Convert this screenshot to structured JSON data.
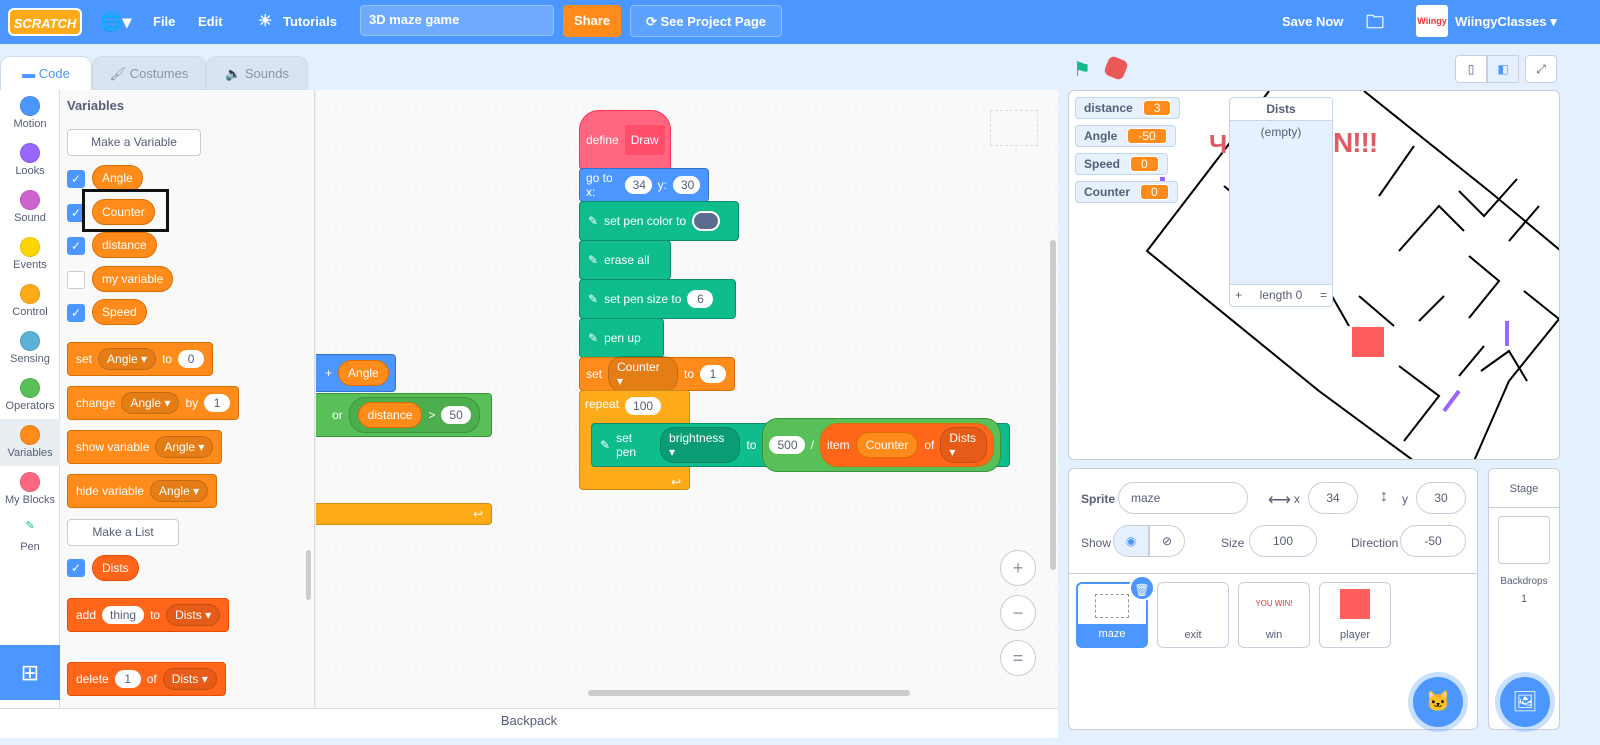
{
  "menu": {
    "logo": "SCRATCH",
    "file": "File",
    "edit": "Edit",
    "tutorials": "Tutorials",
    "project_title": "3D maze game",
    "share": "Share",
    "see_project": "See Project Page",
    "save_now": "Save Now",
    "username": "WiingyClasses",
    "avatar_text": "Wiingy"
  },
  "tabs": {
    "code": "Code",
    "costumes": "Costumes",
    "sounds": "Sounds"
  },
  "categories": [
    {
      "label": "Motion",
      "color": "#4c97ff"
    },
    {
      "label": "Looks",
      "color": "#9966ff"
    },
    {
      "label": "Sound",
      "color": "#cf63cf"
    },
    {
      "label": "Events",
      "color": "#ffd500"
    },
    {
      "label": "Control",
      "color": "#ffab19"
    },
    {
      "label": "Sensing",
      "color": "#5cb1d6"
    },
    {
      "label": "Operators",
      "color": "#59c059"
    },
    {
      "label": "Variables",
      "color": "#ff8c1a"
    },
    {
      "label": "My Blocks",
      "color": "#ff6680"
    },
    {
      "label": "Pen",
      "color": "#0fbd8c"
    }
  ],
  "palette": {
    "heading": "Variables",
    "make_variable": "Make a Variable",
    "variables": [
      {
        "name": "Angle",
        "checked": true
      },
      {
        "name": "Counter",
        "checked": true
      },
      {
        "name": "distance",
        "checked": true
      },
      {
        "name": "my variable",
        "checked": false
      },
      {
        "name": "Speed",
        "checked": true
      }
    ],
    "set": {
      "a": "set",
      "var": "Angle",
      "to": "to",
      "val": "0"
    },
    "change": {
      "a": "change",
      "var": "Angle",
      "by": "by",
      "val": "1"
    },
    "show": {
      "a": "show variable",
      "var": "Angle"
    },
    "hide": {
      "a": "hide variable",
      "var": "Angle"
    },
    "make_list": "Make a List",
    "list": {
      "name": "Dists",
      "checked": true
    },
    "add": {
      "a": "add",
      "val": "thing",
      "to": "to",
      "list": "Dists"
    },
    "delete": {
      "a": "delete",
      "val": "1",
      "of": "of",
      "list": "Dists"
    }
  },
  "bg_script": {
    "plus": "+",
    "angle": "Angle",
    "or": "or",
    "distance": "distance",
    "gt": ">",
    "val": "50"
  },
  "script": {
    "define": "define",
    "name": "Draw",
    "goto": "go to x:",
    "x": "34",
    "y_label": "y:",
    "y": "30",
    "pencolor": "set pen color to",
    "pencolor_value": "#5b6c8f",
    "erase": "erase all",
    "pensize": "set pen size to",
    "size": "6",
    "penup": "pen up",
    "set": "set",
    "var": "Counter",
    "to": "to",
    "setval": "1",
    "repeat": "repeat",
    "times": "100",
    "setpen": "set pen",
    "param": "brightness",
    "to2": "to",
    "num": "500",
    "div": "/",
    "item": "item",
    "item_idx": "Counter",
    "of": "of",
    "list": "Dists"
  },
  "workspace": {
    "zoom_in": "+",
    "zoom_out": "−",
    "reset": "="
  },
  "backpack": "Backpack",
  "monitors": [
    {
      "name": "distance",
      "value": "3"
    },
    {
      "name": "Angle",
      "value": "-50"
    },
    {
      "name": "Speed",
      "value": "0"
    },
    {
      "name": "Counter",
      "value": "0"
    }
  ],
  "list_monitor": {
    "title": "Dists",
    "empty": "(empty)",
    "add": "+",
    "length": "length 0",
    "resize": "="
  },
  "stage_text": "N!!!",
  "sprite_info": {
    "sprite_label": "Sprite",
    "name": "maze",
    "x_label": "x",
    "x": "34",
    "y_label": "y",
    "y": "30",
    "show_label": "Show",
    "size_label": "Size",
    "size": "100",
    "direction_label": "Direction",
    "direction": "-50"
  },
  "sprites": [
    {
      "name": "maze",
      "selected": true
    },
    {
      "name": "exit"
    },
    {
      "name": "win",
      "thumb_text": "YOU WIN!"
    },
    {
      "name": "player"
    }
  ],
  "stage_panel": {
    "title": "Stage",
    "backdrops_label": "Backdrops",
    "backdrops": "1"
  }
}
